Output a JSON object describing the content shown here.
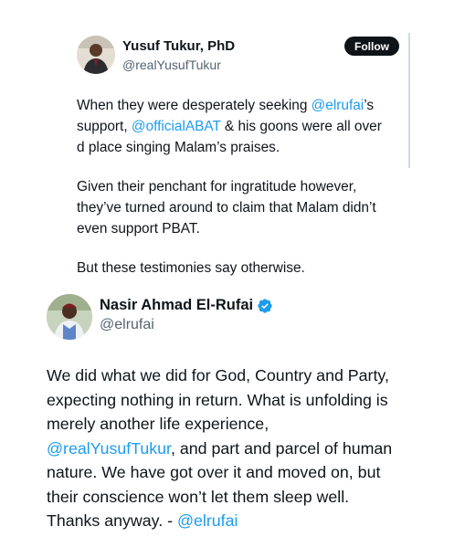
{
  "quoted_tweet": {
    "author_name": "Yusuf Tukur, PhD",
    "author_handle": "@realYusufTukur",
    "follow_label": "Follow",
    "paragraph1": {
      "t1": "When they were desperately seeking ",
      "m1": "@elrufai",
      "t2": "’s",
      "t3": "support, ",
      "m2": "@officialABAT",
      "t4": " & his goons were all over",
      "t5": "d place singing Malam’s praises."
    },
    "paragraph2": {
      "l1": "Given their penchant for ingratitude however,",
      "l2": "they’ve turned around to claim that Malam didn’t",
      "l3": "even support PBAT."
    },
    "paragraph3": "But these testimonies say otherwise."
  },
  "main_tweet": {
    "author_name": "Nasir Ahmad El-Rufai",
    "author_handle": "@elrufai",
    "verified_icon": "verified-badge-icon",
    "verified_color": "#1d9bf0",
    "body": {
      "l1": "We did what we did for God, Country and Party,",
      "l2": "expecting nothing in return. What is unfolding is",
      "l3": "merely another life experience,",
      "l4_mention": "@realYusufTukur",
      "l4_rest": ", and part and parcel of human",
      "l5": "nature. We have got over it and moved on, but",
      "l6": "their conscience won’t let them sleep well.",
      "l7_text": "Thanks anyway. - ",
      "l7_mention": "@elrufai"
    }
  },
  "colors": {
    "text": "#0f1419",
    "secondary": "#536471",
    "mention": "#1d9bf0",
    "follow_bg": "#0f1419"
  }
}
